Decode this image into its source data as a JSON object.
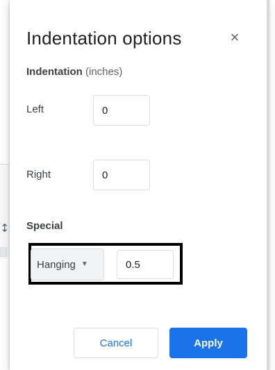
{
  "background": {
    "glyph": "↕:"
  },
  "dialog": {
    "title": "Indentation options",
    "close_glyph": "×",
    "section": {
      "label": "Indentation",
      "unit": "(inches)"
    },
    "left": {
      "label": "Left",
      "value": "0"
    },
    "right": {
      "label": "Right",
      "value": "0"
    },
    "special": {
      "label": "Special",
      "selected": "Hanging",
      "caret": "▼",
      "value": "0.5"
    },
    "buttons": {
      "cancel": "Cancel",
      "apply": "Apply"
    }
  },
  "colors": {
    "accent": "#1a73e8",
    "highlight_border": "#000000",
    "dropdown_bg": "#f1f3f4"
  },
  "icons": {
    "close": "close-icon",
    "dropdown": "chevron-down-icon"
  }
}
